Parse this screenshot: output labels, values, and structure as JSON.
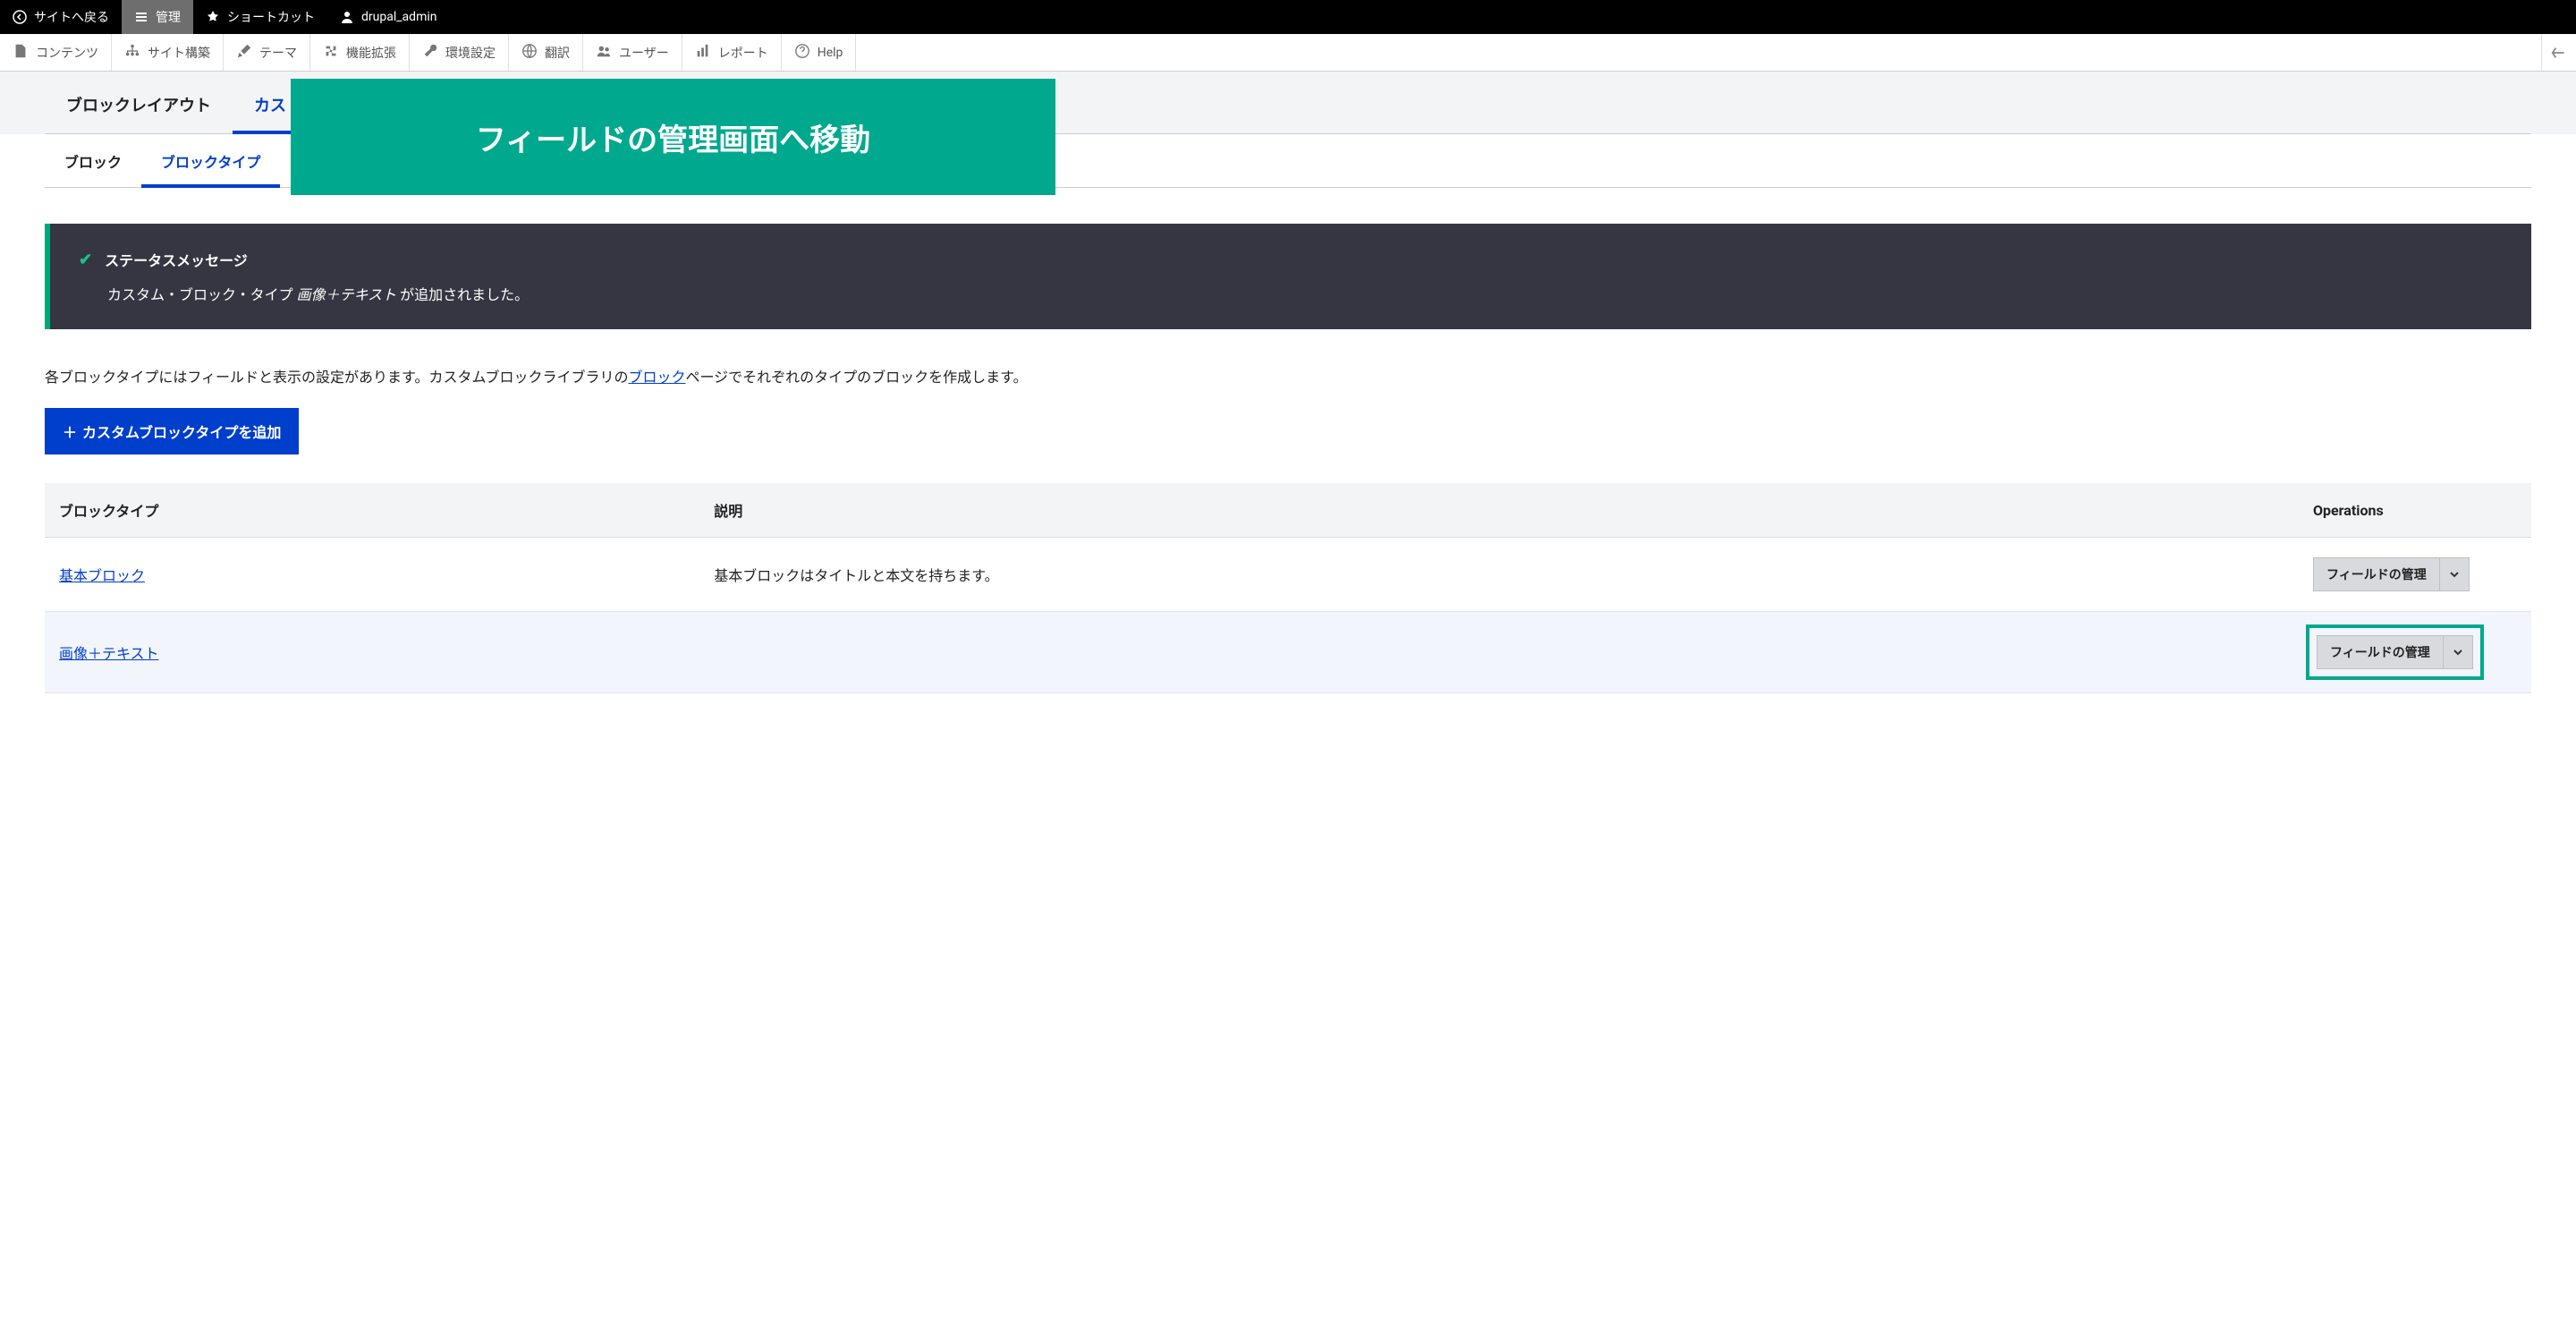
{
  "topbar": {
    "back": "サイトへ戻る",
    "manage": "管理",
    "shortcuts": "ショートカット",
    "user": "drupal_admin"
  },
  "toolbar": {
    "items": [
      {
        "label": "コンテンツ"
      },
      {
        "label": "サイト構築"
      },
      {
        "label": "テーマ"
      },
      {
        "label": "機能拡張"
      },
      {
        "label": "環境設定"
      },
      {
        "label": "翻訳"
      },
      {
        "label": "ユーザー"
      },
      {
        "label": "レポート"
      },
      {
        "label": "Help"
      }
    ]
  },
  "overlay_text": "フィールドの管理画面へ移動",
  "primary_tabs": [
    {
      "label": "ブロックレイアウト",
      "active": false
    },
    {
      "label": "カス",
      "active": true
    }
  ],
  "secondary_tabs": [
    {
      "label": "ブロック",
      "active": false
    },
    {
      "label": "ブロックタイプ",
      "active": true
    }
  ],
  "status": {
    "title": "ステータスメッセージ",
    "prefix": "カスタム・ブロック・タイプ",
    "em": "画像＋テキスト",
    "suffix": "が追加されました。"
  },
  "intro": {
    "before": "各ブロックタイプにはフィールドと表示の設定があります。カスタムブロックライブラリの",
    "link": "ブロック",
    "after": "ページでそれぞれのタイプのブロックを作成します。"
  },
  "add_button": "カスタムブロックタイプを追加",
  "table": {
    "headers": [
      "ブロックタイプ",
      "説明",
      "Operations"
    ],
    "rows": [
      {
        "name": "基本ブロック",
        "desc": "基本ブロックはタイトルと本文を持ちます。",
        "op": "フィールドの管理",
        "highlight": false
      },
      {
        "name": "画像＋テキスト",
        "desc": "",
        "op": "フィールドの管理",
        "highlight": true
      }
    ]
  }
}
